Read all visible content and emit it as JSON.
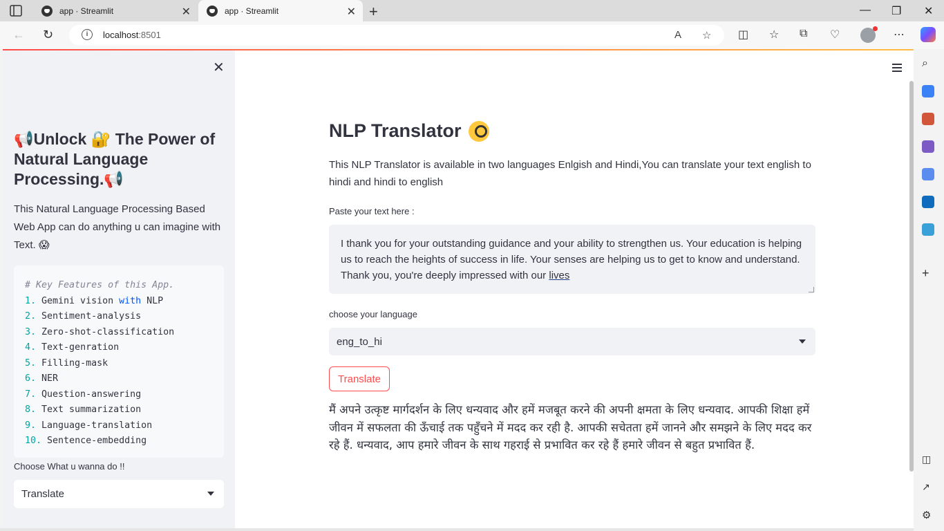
{
  "browser": {
    "tabs": [
      {
        "title": "app · Streamlit",
        "active": false
      },
      {
        "title": "app · Streamlit",
        "active": true
      }
    ],
    "url_host": "localhost",
    "url_port": ":8501"
  },
  "sidebar": {
    "title": "📢Unlock 🔐 The Power of Natural Language Processing.📢",
    "description": "This Natural Language Processing Based Web App can do anything u can imagine with Text. 😱",
    "code_comment": "# Key Features of this App.",
    "features": [
      {
        "num": "1.",
        "pre": " Gemini vision ",
        "kw": "with",
        "post": " NLP"
      },
      {
        "num": "2.",
        "pre": " Sentiment",
        "kw": "",
        "post": "-analysis"
      },
      {
        "num": "3.",
        "pre": " Zero",
        "kw": "",
        "post": "-shot-classification"
      },
      {
        "num": "4.",
        "pre": " Text",
        "kw": "",
        "post": "-genration"
      },
      {
        "num": "5.",
        "pre": " Filling",
        "kw": "",
        "post": "-mask"
      },
      {
        "num": "6.",
        "pre": " NER",
        "kw": "",
        "post": ""
      },
      {
        "num": "7.",
        "pre": " Question",
        "kw": "",
        "post": "-answering"
      },
      {
        "num": "8.",
        "pre": " Text summarization",
        "kw": "",
        "post": ""
      },
      {
        "num": "9.",
        "pre": " Language",
        "kw": "",
        "post": "-translation"
      },
      {
        "num": "10.",
        "pre": " Sentence",
        "kw": "",
        "post": "-embedding"
      }
    ],
    "choose_label": "Choose What u wanna do !!",
    "choose_value": "Translate"
  },
  "main": {
    "title": "NLP Translator",
    "description": "This NLP Translator is available in two languages Enlgish and Hindi,You can translate your text english to hindi and hindi to english",
    "input_label": "Paste your text here :",
    "input_text_start": "I thank you for your outstanding guidance and your ability to strengthen us. Your education is helping us to reach the heights of success in life. Your senses are helping us to get to know and understand. Thank you, you're deeply impressed with our ",
    "input_text_underlined": "lives",
    "language_label": "choose your language",
    "language_value": "eng_to_hi",
    "translate_button": "Translate",
    "output_text": "मैं अपने उत्कृष्ट मार्गदर्शन के लिए धन्यवाद और हमें मजबूत करने की अपनी क्षमता के लिए धन्यवाद. आपकी शिक्षा हमें जीवन में सफलता की ऊँचाई तक पहुँचने में मदद कर रही है. आपकी सचेतता हमें जानने और समझने के लिए मदद कर रहे हैं. धन्यवाद, आप हमारे जीवन के साथ गहराई से प्रभावित कर रहे हैं हमारे जीवन से बहुत प्रभावित हैं."
  },
  "colors": {
    "accent": "#ff4b4b",
    "sidebar_bg": "#f0f2f6",
    "text": "#31333f"
  }
}
